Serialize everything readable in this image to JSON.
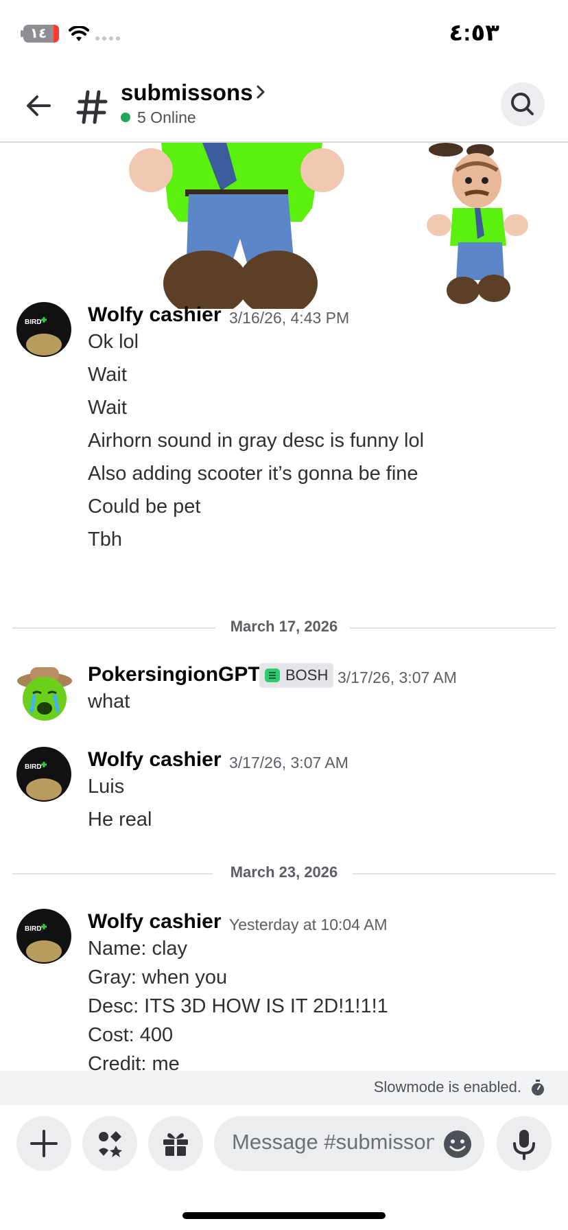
{
  "status_bar": {
    "battery": "١٤",
    "time": "٤:٥٣"
  },
  "header": {
    "channel": "submissons",
    "online": "5 Online"
  },
  "messages": [
    {
      "author": "Wolfy cashier",
      "timestamp": "3/16/26, 4:43 PM",
      "lines": [
        "Ok lol",
        "Wait",
        "Wait",
        "Airhorn sound in gray desc is funny lol",
        "Also adding scooter it’s gonna be fine",
        "Could be pet",
        "Tbh"
      ]
    },
    {
      "author": "PokersingionGPT",
      "badge": "BOSH",
      "timestamp": "3/17/26, 3:07 AM",
      "lines": [
        "what"
      ]
    },
    {
      "author": "Wolfy cashier",
      "timestamp": "3/17/26, 3:07 AM",
      "lines": [
        "Luis",
        "He real"
      ]
    },
    {
      "author": "Wolfy cashier",
      "timestamp": "Yesterday at 10:04 AM",
      "lines": [
        "Name: clay",
        "Gray: when you",
        "Desc: ITS 3D HOW IS IT 2D!1!1!1",
        "Cost: 400",
        "Credit: me"
      ]
    }
  ],
  "dividers": [
    "March 17, 2026",
    "March 23, 2026"
  ],
  "avatar_text": "BIRD",
  "slowmode": "Slowmode is enabled.",
  "composer": {
    "placeholder": "Message #submissons"
  },
  "colors": {
    "online": "#23a55a",
    "badge_bg": "#e3e5e8",
    "input_bg": "#ebedef"
  }
}
